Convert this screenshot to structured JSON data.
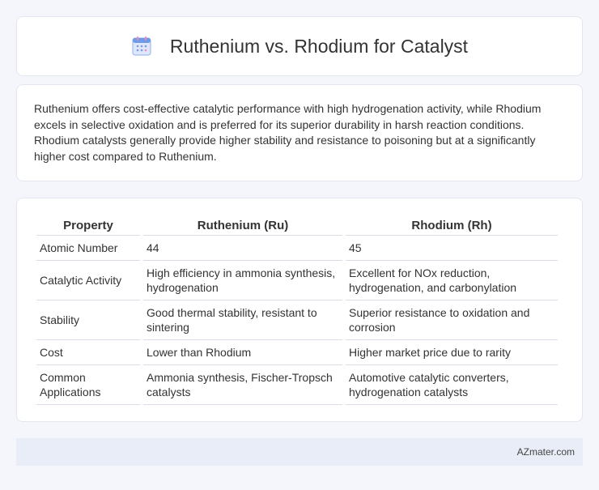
{
  "header": {
    "title": "Ruthenium vs. Rhodium for Catalyst",
    "icon": "calendar-icon"
  },
  "summary": {
    "text": "Ruthenium offers cost-effective catalytic performance with high hydrogenation activity, while Rhodium excels in selective oxidation and is preferred for its superior durability in harsh reaction conditions. Rhodium catalysts generally provide higher stability and resistance to poisoning but at a significantly higher cost compared to Ruthenium."
  },
  "table": {
    "headers": [
      "Property",
      "Ruthenium (Ru)",
      "Rhodium (Rh)"
    ],
    "rows": [
      [
        "Atomic Number",
        "44",
        "45"
      ],
      [
        "Catalytic Activity",
        "High efficiency in ammonia synthesis, hydrogenation",
        "Excellent for NOx reduction, hydrogenation, and carbonylation"
      ],
      [
        "Stability",
        "Good thermal stability, resistant to sintering",
        "Superior resistance to oxidation and corrosion"
      ],
      [
        "Cost",
        "Lower than Rhodium",
        "Higher market price due to rarity"
      ],
      [
        "Common Applications",
        "Ammonia synthesis, Fischer-Tropsch catalysts",
        "Automotive catalytic converters, hydrogenation catalysts"
      ]
    ]
  },
  "footer": {
    "text": "AZmater.com"
  },
  "colors": {
    "background": "#f4f6fb",
    "card": "#ffffff",
    "footer_bg": "#e9edf7",
    "icon_blue": "#5b8def",
    "icon_pink": "#f08bb0"
  }
}
